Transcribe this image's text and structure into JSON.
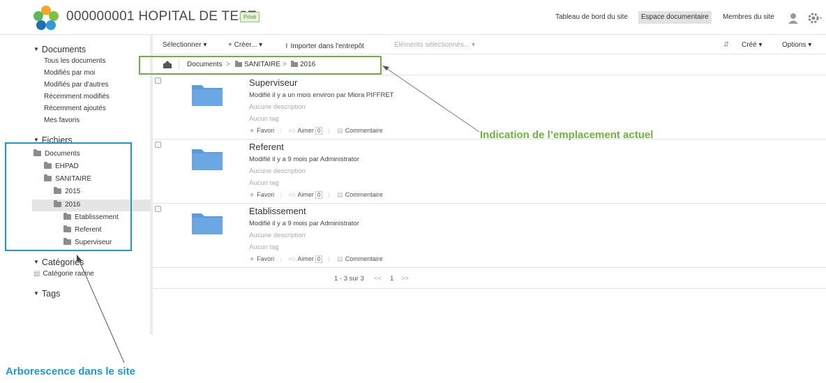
{
  "header": {
    "site_title": "000000001 HOPITAL DE TEST",
    "badge": "Privé",
    "nav": [
      "Tableau de bord du site",
      "Espace documentaire",
      "Membres du site"
    ]
  },
  "sidebar": {
    "documents_head": "Documents",
    "document_links": [
      "Tous les documents",
      "Modifiés par moi",
      "Modifiés par d'autres",
      "Récemment modifiés",
      "Récemment ajoutés",
      "Mes favoris"
    ],
    "fichiers_head": "Fichiers",
    "tree": [
      "Documents",
      "EHPAD",
      "SANITAIRE",
      "2015",
      "2016",
      "Etablissement",
      "Referent",
      "Superviseur"
    ],
    "categories_head": "Catégories",
    "categorie_racine": "Catégorie racine",
    "tags_head": "Tags"
  },
  "toolbar": {
    "select": "Sélectionner ▾",
    "create": "+ Créer... ▾",
    "import": "Importer dans l'entrepôt",
    "selected_items": "Eléments sélectionnés... ▾",
    "sort": "Créé ▾",
    "options": "Options ▾"
  },
  "breadcrumb": {
    "root": "Documents",
    "level1": "SANITAIRE",
    "level2": "2016"
  },
  "rows": [
    {
      "title": "Superviseur",
      "modified": "Modifié il y a un mois environ par Miora PIFFRET",
      "description": "Aucune description",
      "tags": "Aucun tag",
      "favorite": "Favori",
      "like": "Aimer",
      "likes": "0",
      "comment": "Commentaire"
    },
    {
      "title": "Referent",
      "modified": "Modifié il y a 9 mois par Administrator",
      "description": "Aucune description",
      "tags": "Aucun tag",
      "favorite": "Favori",
      "like": "Aimer",
      "likes": "0",
      "comment": "Commentaire"
    },
    {
      "title": "Etablissement",
      "modified": "Modifié il y a 9 mois par Administrator",
      "description": "Aucune description",
      "tags": "Aucun tag",
      "favorite": "Favori",
      "like": "Aimer",
      "likes": "0",
      "comment": "Commentaire"
    }
  ],
  "pager": {
    "range": "1 - 3 sur 3",
    "prev": "<<",
    "page": "1",
    "next": ">>"
  },
  "annotations": {
    "current_location": "Indication de l’emplacement actuel",
    "tree": "Arborescence dans le site",
    "green": "#6db33f",
    "blue": "#1a9ad0"
  }
}
